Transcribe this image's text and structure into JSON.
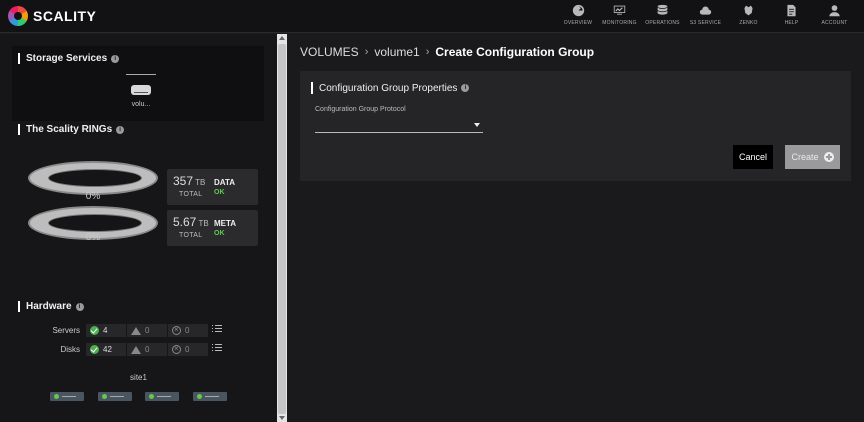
{
  "app": {
    "brand": "SCALITY"
  },
  "nav": [
    {
      "label": "OVERVIEW",
      "icon": "gauge-icon"
    },
    {
      "label": "MONITORING",
      "icon": "monitor-icon"
    },
    {
      "label": "OPERATIONS",
      "icon": "database-icon"
    },
    {
      "label": "S3 SERVICE",
      "icon": "s3-cloud-icon"
    },
    {
      "label": "ZENKO",
      "icon": "zenko-icon"
    },
    {
      "label": "HELP",
      "icon": "document-icon"
    },
    {
      "label": "ACCOUNT",
      "icon": "user-icon"
    }
  ],
  "sidebar": {
    "storage_title": "Storage Services",
    "volume_label": "volu...",
    "rings_title": "The Scality RINGs",
    "rings": [
      {
        "pct": "0%",
        "value": "357",
        "unit": "TB",
        "total": "TOTAL",
        "kind": "DATA",
        "status": "OK"
      },
      {
        "pct": "0%",
        "value": "5.67",
        "unit": "TB",
        "total": "TOTAL",
        "kind": "META",
        "status": "OK"
      }
    ],
    "hardware_title": "Hardware",
    "hardware": [
      {
        "label": "Servers",
        "ok": "4",
        "warn": "0",
        "err": "0"
      },
      {
        "label": "Disks",
        "ok": "42",
        "warn": "0",
        "err": "0"
      }
    ],
    "site_label": "site1"
  },
  "breadcrumb": {
    "root": "VOLUMES",
    "volume": "volume1",
    "current": "Create Configuration Group"
  },
  "panel": {
    "title": "Configuration Group Properties",
    "field_label": "Configuration Group Protocol",
    "field_value": ""
  },
  "buttons": {
    "cancel": "Cancel",
    "create": "Create"
  }
}
